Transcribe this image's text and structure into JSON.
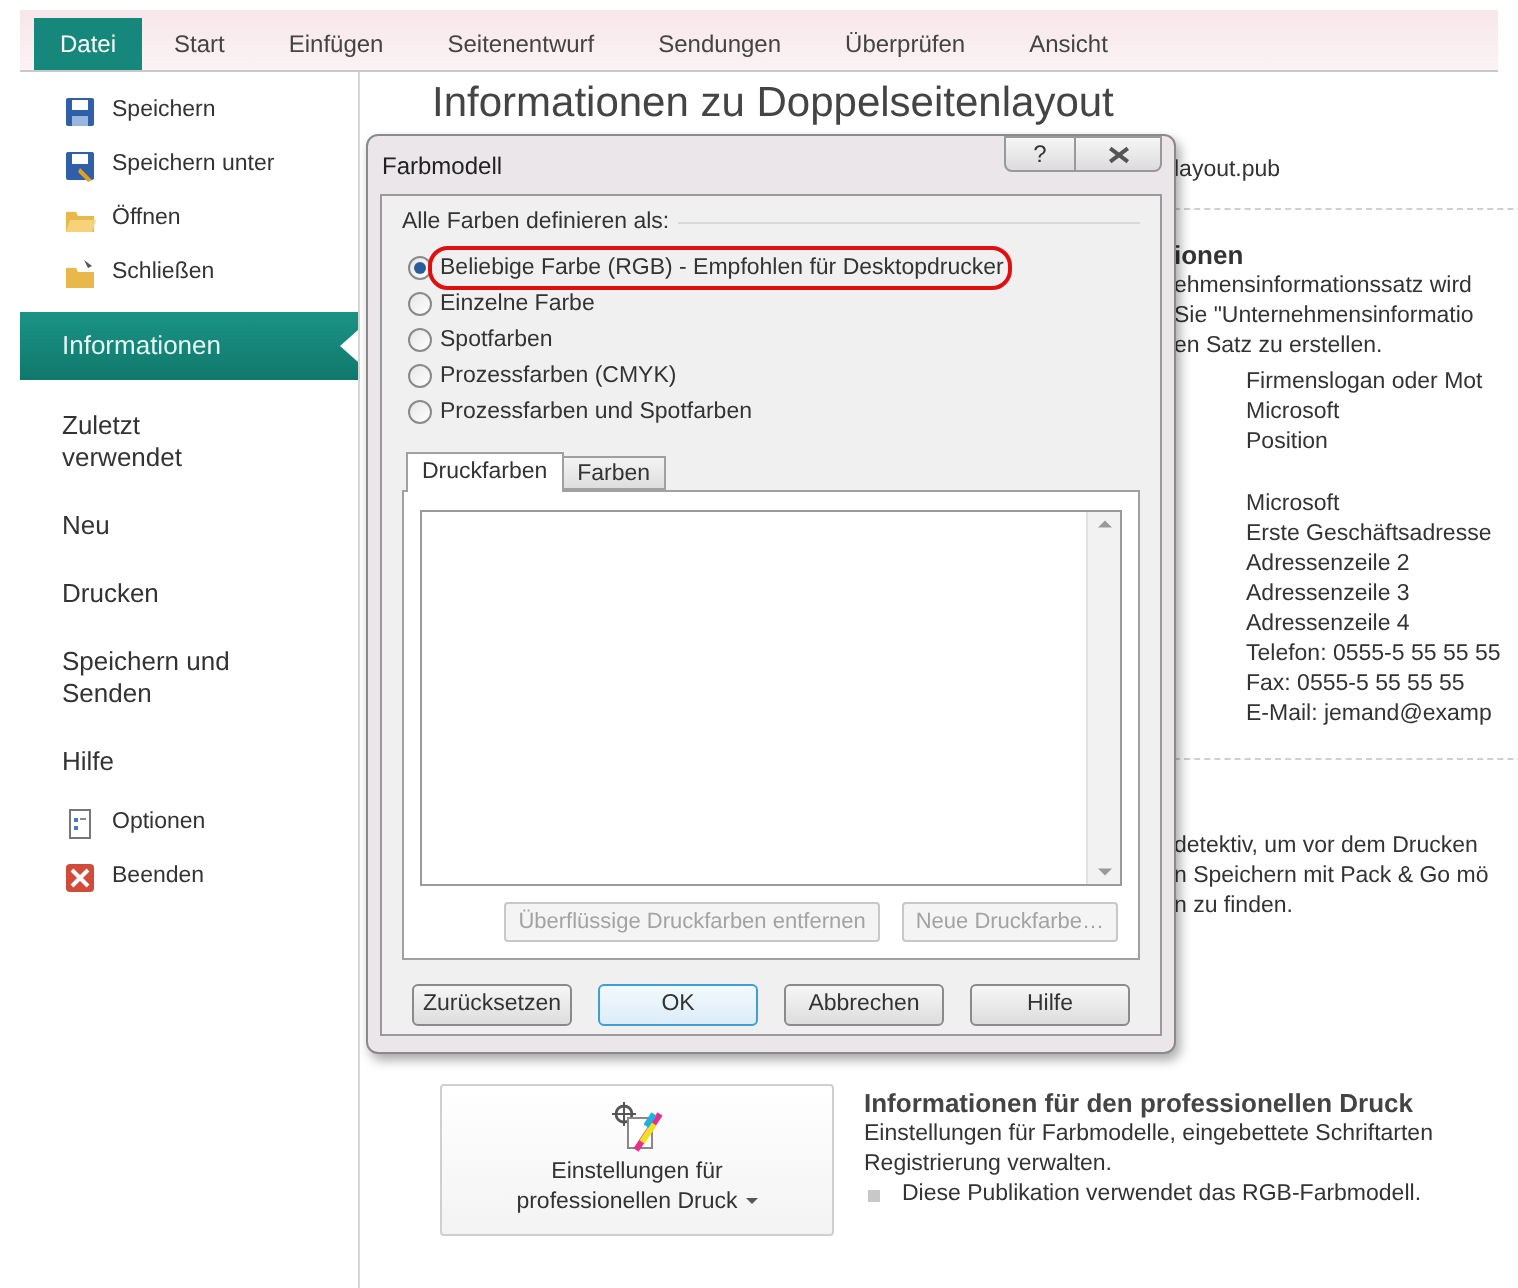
{
  "ribbon_tabs": [
    {
      "label": "Datei",
      "selected": true
    },
    {
      "label": "Start",
      "selected": false
    },
    {
      "label": "Einfügen",
      "selected": false
    },
    {
      "label": "Seitenentwurf",
      "selected": false
    },
    {
      "label": "Sendungen",
      "selected": false
    },
    {
      "label": "Überprüfen",
      "selected": false
    },
    {
      "label": "Ansicht",
      "selected": false
    }
  ],
  "sidebar": {
    "items": [
      {
        "kind": "command",
        "label": "Speichern",
        "selected": false
      },
      {
        "kind": "command",
        "label": "Speichern unter",
        "selected": false
      },
      {
        "kind": "command",
        "label": "Öffnen",
        "selected": false
      },
      {
        "kind": "command",
        "label": "Schließen",
        "selected": false
      },
      {
        "kind": "page",
        "label": "Informationen",
        "selected": true
      },
      {
        "kind": "page",
        "label": "Zuletzt verwendet",
        "selected": false
      },
      {
        "kind": "page",
        "label": "Neu",
        "selected": false
      },
      {
        "kind": "page",
        "label": "Drucken",
        "selected": false
      },
      {
        "kind": "page",
        "label": "Speichern und Senden",
        "selected": false
      },
      {
        "kind": "page",
        "label": "Hilfe",
        "selected": false
      },
      {
        "kind": "command",
        "label": "Optionen",
        "selected": false
      },
      {
        "kind": "command",
        "label": "Beenden",
        "selected": false
      }
    ]
  },
  "info": {
    "title": "Informationen zu Doppelseitenlayout",
    "file_fragment": "layout.pub",
    "section_heading_fragment": "ionen",
    "section_lines": [
      "ehmensinformationssatz wird",
      "Sie \"Unternehmensinformatio",
      "en Satz zu erstellen."
    ],
    "business_info": [
      [
        "Firmenslogan oder Mot",
        "Microsoft",
        "Position"
      ],
      [
        "Microsoft",
        "Erste Geschäftsadresse",
        "Adressenzeile 2",
        "Adressenzeile 3",
        "Adressenzeile 4",
        "Telefon: 0555-5 55 55 55",
        "Fax: 0555-5 55 55 55",
        "E-Mail: jemand@examp"
      ]
    ],
    "check_lines": [
      "detektiv, um vor dem Drucken",
      "n Speichern mit Pack & Go mö",
      "n zu finden."
    ],
    "print_button": {
      "label": "Einstellungen für professionellen Druck"
    },
    "print_heading": "Informationen für den professionellen Druck",
    "print_lines": [
      "Einstellungen für Farbmodelle, eingebettete Schriftarten",
      "Registrierung verwalten."
    ],
    "print_bullet": "Diese Publikation verwendet das RGB-Farbmodell."
  },
  "dialog": {
    "title": "Farbmodell",
    "help_button": "?",
    "group_label": "Alle Farben definieren als:",
    "options": [
      {
        "label": "Beliebige Farbe (RGB) - Empfohlen für Desktopdrucker",
        "selected": true,
        "highlighted": true
      },
      {
        "label": "Einzelne Farbe",
        "selected": false,
        "highlighted": false
      },
      {
        "label": "Spotfarben",
        "selected": false,
        "highlighted": false
      },
      {
        "label": "Prozessfarben (CMYK)",
        "selected": false,
        "highlighted": false
      },
      {
        "label": "Prozessfarben und Spotfarben",
        "selected": false,
        "highlighted": false
      }
    ],
    "tabs": [
      {
        "label": "Druckfarben",
        "selected": true
      },
      {
        "label": "Farben",
        "selected": false
      }
    ],
    "panel_buttons": [
      {
        "label": "Überflüssige Druckfarben entfernen",
        "disabled": true
      },
      {
        "label": "Neue Druckfarbe…",
        "disabled": true
      }
    ],
    "buttons": [
      {
        "label": "Zurücksetzen",
        "default": false
      },
      {
        "label": "OK",
        "default": true
      },
      {
        "label": "Abbrechen",
        "default": false
      },
      {
        "label": "Hilfe",
        "default": false
      }
    ]
  }
}
